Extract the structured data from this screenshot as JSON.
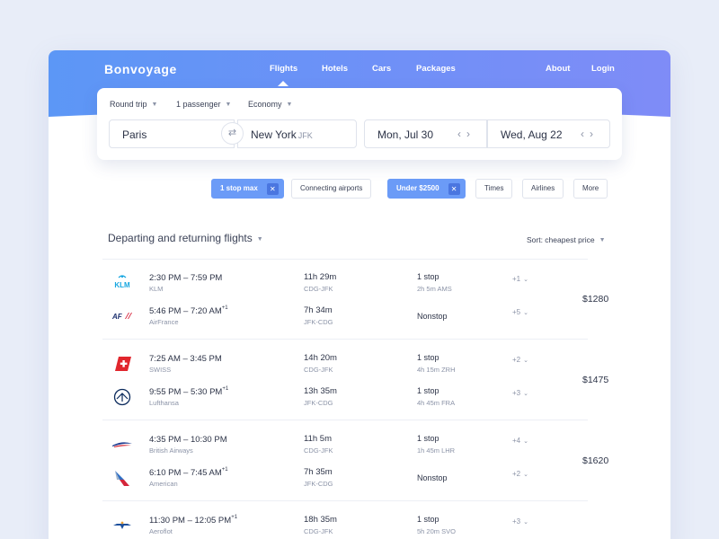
{
  "brand": "Bonvoyage",
  "nav": {
    "flights": "Flights",
    "hotels": "Hotels",
    "cars": "Cars",
    "packages": "Packages",
    "about": "About",
    "login": "Login"
  },
  "search": {
    "trip_type": "Round trip",
    "passengers": "1 passenger",
    "cabin": "Economy",
    "from": "Paris",
    "to_city": "New York",
    "to_code": "JFK",
    "depart_date": "Mon, Jul 30",
    "return_date": "Wed, Aug 22"
  },
  "filters": [
    {
      "label": "1 stop max",
      "active": true
    },
    {
      "label": "Connecting airports",
      "active": false
    },
    {
      "label": "Under $2500",
      "active": true
    },
    {
      "label": "Times",
      "active": false
    },
    {
      "label": "Airlines",
      "active": false
    },
    {
      "label": "More",
      "active": false
    }
  ],
  "results": {
    "title": "Departing and returning flights",
    "sort": "Sort: cheapest price",
    "itineraries": [
      {
        "price": "$1280",
        "legs": [
          {
            "logo": "klm-logo",
            "time": "2:30 PM – 7:59 PM",
            "plus_day": "",
            "airline": "KLM",
            "duration": "11h 29m",
            "route": "CDG-JFK",
            "stops": "1 stop",
            "layover": "2h 5m AMS",
            "more": "+1"
          },
          {
            "logo": "airfrance-logo",
            "time": "5:46 PM – 7:20 AM",
            "plus_day": "+1",
            "airline": "AirFrance",
            "duration": "7h 34m",
            "route": "JFK-CDG",
            "stops": "Nonstop",
            "layover": "",
            "more": "+5"
          }
        ]
      },
      {
        "price": "$1475",
        "legs": [
          {
            "logo": "swiss-logo",
            "time": "7:25 AM – 3:45 PM",
            "plus_day": "",
            "airline": "SWISS",
            "duration": "14h 20m",
            "route": "CDG-JFK",
            "stops": "1 stop",
            "layover": "4h 15m ZRH",
            "more": "+2"
          },
          {
            "logo": "lufthansa-logo",
            "time": "9:55 PM – 5:30 PM",
            "plus_day": "+1",
            "airline": "Lufthansa",
            "duration": "13h 35m",
            "route": "JFK-CDG",
            "stops": "1 stop",
            "layover": "4h 45m FRA",
            "more": "+3"
          }
        ]
      },
      {
        "price": "$1620",
        "legs": [
          {
            "logo": "british-airways-logo",
            "time": "4:35 PM – 10:30 PM",
            "plus_day": "",
            "airline": "British Airways",
            "duration": "11h 5m",
            "route": "CDG-JFK",
            "stops": "1 stop",
            "layover": "1h 45m LHR",
            "more": "+4"
          },
          {
            "logo": "american-logo",
            "time": "6:10 PM – 7:45 AM",
            "plus_day": "+1",
            "airline": "American",
            "duration": "7h 35m",
            "route": "JFK-CDG",
            "stops": "Nonstop",
            "layover": "",
            "more": "+2"
          }
        ]
      },
      {
        "price": "",
        "legs": [
          {
            "logo": "aeroflot-logo",
            "time": "11:30 PM – 12:05 PM",
            "plus_day": "+1",
            "airline": "Aeroflot",
            "duration": "18h 35m",
            "route": "CDG-JFK",
            "stops": "1 stop",
            "layover": "5h 20m SVO",
            "more": "+3"
          }
        ]
      }
    ]
  },
  "colors": {
    "header_start": "#5c97f6",
    "header_end": "#7f8cf7",
    "chip_active": "#6b9bf7",
    "text_muted": "#8b93a7"
  }
}
